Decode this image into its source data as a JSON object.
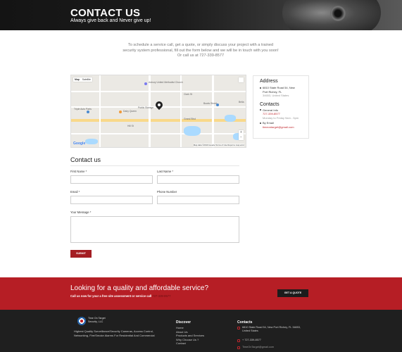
{
  "hero": {
    "title": "CONTACT US",
    "subtitle": "Always give back and Never give up!"
  },
  "intro": {
    "line1": "To schedule a service call, get a quote, or simply discuss your project with a trained",
    "line2": "security system professional, fill out the form below and we will be in touch with you soon!",
    "line3": "Or call us at 727-339-8577"
  },
  "map": {
    "tab_map": "Map",
    "tab_satellite": "Satellite",
    "labels": [
      "Asbury United Methodist Church",
      "Public Storage",
      "Dairy Queen",
      "Bowls Street",
      "Triple Auto Parts",
      "Clark St",
      "Grand Blvd",
      "Hill St",
      "Bella"
    ],
    "zoom_in": "+",
    "zoom_out": "−",
    "attribution": "Google",
    "footer": "Map data ©2019 Google   Terms of Use   Report a map error"
  },
  "sidebar": {
    "address_heading": "Address",
    "address_line1": "6810 State Road 54, New",
    "address_line2": "Port Richey, FL",
    "address_line3": "34653, United States",
    "contacts_heading": "Contacts",
    "general_label": "General Info",
    "general_phone": "727-339-8577",
    "general_hours": "Monday to Friday 9am - 5pm",
    "email_label": "By Email",
    "email": "timeontarget@gmail.com"
  },
  "form": {
    "title": "Contact us",
    "first_name_label": "First Name *",
    "last_name_label": "Last Name *",
    "email_label": "Email *",
    "phone_label": "Phone Number",
    "message_label": "Your Message *",
    "submit_label": "SUBMIT"
  },
  "cta": {
    "title": "Looking for a quality and affordable service?",
    "subtitle": "Call us now for your a free site assessment or service call",
    "phone": "727-339-8577",
    "button_label": "GET A QUOTE"
  },
  "footer": {
    "logo_line1": "Time On Target",
    "logo_line2": "Security, LLC",
    "description": "Highest Quality Surveillance/Security Cameras, Access Control, Networking, Fire/Smoke Alarms For Residential And Commercial",
    "discover_heading": "Discover",
    "links": [
      "Home",
      "About Us",
      "Products and Services",
      "Why Choose Us ?",
      "Contact"
    ],
    "contacts_heading": "Contacts",
    "address_line1": "6810 State Road 54, New Port Richey, FL 34653,",
    "address_line2": "United States",
    "phone": "+ 727-339-8577",
    "email": "TimeOnTarget@gmail.com"
  },
  "colors": {
    "accent_red": "#b61e25",
    "button_red": "#a41e23",
    "dark": "#1f1f1f"
  }
}
